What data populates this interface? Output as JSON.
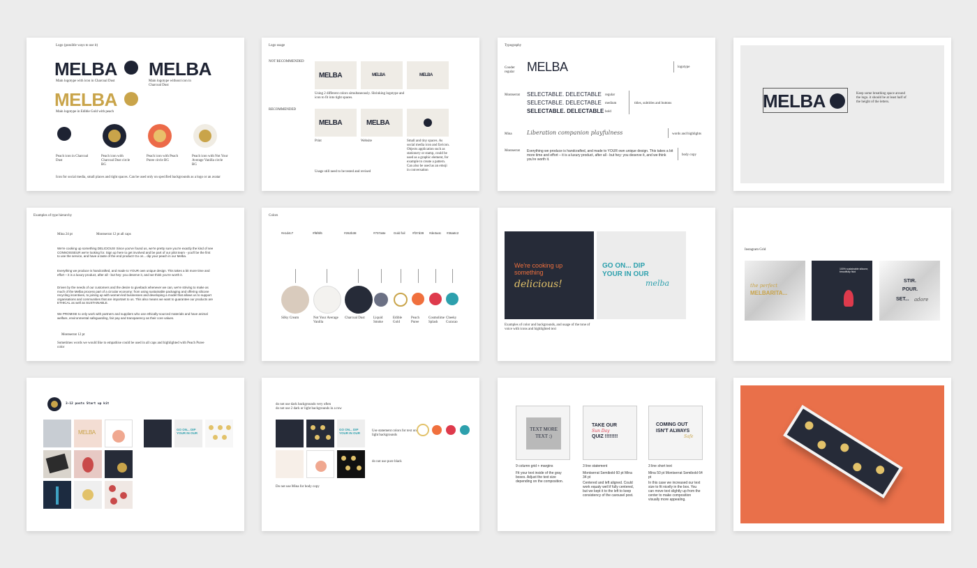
{
  "card1": {
    "title": "Logo (possible ways to use it)",
    "logo": "MELBA",
    "cap_main": "Main logotype with icon in Charcoal Dust",
    "cap_noicon": "Main logotype without icon in Charcoal Dust",
    "cap_gold": "Main logotype in Edible Gold with peach",
    "icons": [
      "Peach icon in Charcoal Dust",
      "Peach icon with Charcoal Dust circle BG",
      "Peach icon with Peach Puree circle BG",
      "Peach icon with Not Your Average Vanilla circle BG"
    ],
    "footer": "Icon for social media, small places and tight spaces. Can be used only on specified backgrounds as a logo or an avatar"
  },
  "card2": {
    "title": "Logo usage",
    "not_rec": "NOT RECOMMENDED",
    "rec": "RECOMMENDED",
    "logo": "MELBA",
    "note1": "Using 2 different colors simultaneously. Shrinking logotype and icon to fit into tight spaces.",
    "print": "Print",
    "website": "Website",
    "small": "Small and tiny spaces. As social media icon and favicon. Objects application such as stationery or stamp, could be used as a graphic element, for example to create a pattern. Can also be used as an emoji in conversation",
    "note2": "Usage still need to be tested and revised"
  },
  "card3": {
    "title": "Typography",
    "cooder": "Cooder regular",
    "logo": "MELBA",
    "logotype": "logotype",
    "montserrat": "Montserrat",
    "sel": "SELECTABLE. DELECTABLE",
    "regular": "regular",
    "medium": "medium",
    "bold": "bold",
    "titles": "titles, subtitles and buttons",
    "mina": "Mina",
    "script": "Liberation companion playfulness",
    "words": "words and highlights",
    "montserrat2": "Montserrat",
    "body": "Everything we produce is handcrafted, and made to YOUR own unique design. This takes a bit more time and effort – it is a luxury product, after all - but hey: you deserve it, and we think you're worth it.",
    "bodycopy": "body copy"
  },
  "card4": {
    "logo": "MELBA",
    "note": "Keep some breathing space around the logo. it should be at least half of the height of the letters."
  },
  "card5": {
    "title": "Examples of type hierarchy",
    "mina": "Mina 24 pt",
    "mont12": "Montserrat 12 pt all caps",
    "p1": "We're cooking up something DELICIOUS! Since you've found us, we're pretty sure you're exactly the kind of see CONNOISSEUR we're looking for. Sign up here to get involved and be part of our pilot team - you'll be the first to use the service, and have a taste of the end product! Go on... dip your peach in our Melba.",
    "p2": "Everything we produce is handcrafted, and made to YOUR own unique design. This takes a bit more time and effort – it is a luxury product, after all - but hey: you deserve it, and we think you're worth it.",
    "p3": "Driven by the needs of our customers and the desire to giveback whenever we can, we're striving to make as much of the Melba process part of a circular economy: from using sustainable packaging and offering silicone recycling incentives, to joining up with women-led businesses and developing a model that allows us to support organisations and communities that are important to us. This also means we want to guarantee our products are ETHICAL as well as SUSTAINABLE.",
    "p4": "We PROMISE to only work with partners and suppliers who use ethically-sourced materials and have animal welfare, environmental safeguarding, fair pay and transparency as their core values.",
    "mont12b": "Montserrat 12 pt",
    "foot": "Sometimes words we would like to empathise could be used in all caps and highlighted with Peach Puree color"
  },
  "card6": {
    "title": "Colors",
    "hexes": [
      "#e1d4c7",
      "#f6f6f6",
      "#262b38",
      "#707a8e",
      "Gold foil",
      "#f37d39",
      "#de3a4c",
      "#36a8c2"
    ],
    "names": [
      "Silky Cream",
      "Not Your Average Vanilla",
      "Charcoal Dust",
      "Liquid Smoke",
      "Edible Gold",
      "Peach Puree",
      "Cosmolime Splash",
      "Cheeky Curacao"
    ],
    "colors": [
      "#d9cbbd",
      "#f3f2ef",
      "#262b38",
      "#6b7084",
      "#ffffff",
      "#f0703d",
      "#de3a4c",
      "#2da0ad"
    ]
  },
  "card7": {
    "left1": "We're cooking up something",
    "left2": "delicious!",
    "right1": "GO ON... DIP YOUR IN OUR",
    "right2": "melba",
    "caption": "Examples of color and backgrounds, and usage of the tone of voice with icons and highlighted text"
  },
  "card8": {
    "title": "Instagram Grid",
    "t1a": "the perfect",
    "t1b": "MELBARITA...",
    "t2": "100% sustainable silicone, beautifully fluid",
    "t3a": "STIR. POUR.",
    "t3b": "SET...",
    "t3c": "adore"
  },
  "card9": {
    "title": "3-12 posts Start up kit",
    "logo": "MELBA",
    "goon": "GO ON... DIP YOUR IN OUR"
  },
  "card10": {
    "note1": "do not use dark backgrounds very often",
    "note2": "do not use 2 dark or light backgrounds in a row",
    "note3": "Use statement colors for text on light backgrounds",
    "note4": "do not use pure black",
    "note5": "Do not use Mina for body copy",
    "goon": "GO ON... DIP YOUR IN OUR",
    "colors": [
      "#e2c26a",
      "#f0703d",
      "#de3a4c",
      "#2da0ad"
    ]
  },
  "card11": {
    "g1": "TEXT MORE TEXT :)",
    "g2a": "TAKE OUR",
    "g2b": "Sun Day",
    "g2c": "QUIZ !!!!!!!!",
    "g3a": "COMING OUT ISN'T ALWAYS",
    "g3b": "Safe",
    "c1": "9 column grid + margins",
    "c1b": "Fit your text inside of the gray boxes. Adjust the text size depending on the composition.",
    "c2": "3 line statement",
    "c2b": "Montserrat Semibold 60 pt Mina 34 pt",
    "c2c": "Centered and left aligned. Could work equaly well if fully centered, but we kept it to the left to keep consistency of the carousel post.",
    "c3": "3 line short text",
    "c3b": "Mina 50 pt Montserrat Semibold 64 pt",
    "c3c": "In this case we increased our text size to fit nicelly in the box. You can move text slightly up from the center to make composition visually more appealing."
  }
}
